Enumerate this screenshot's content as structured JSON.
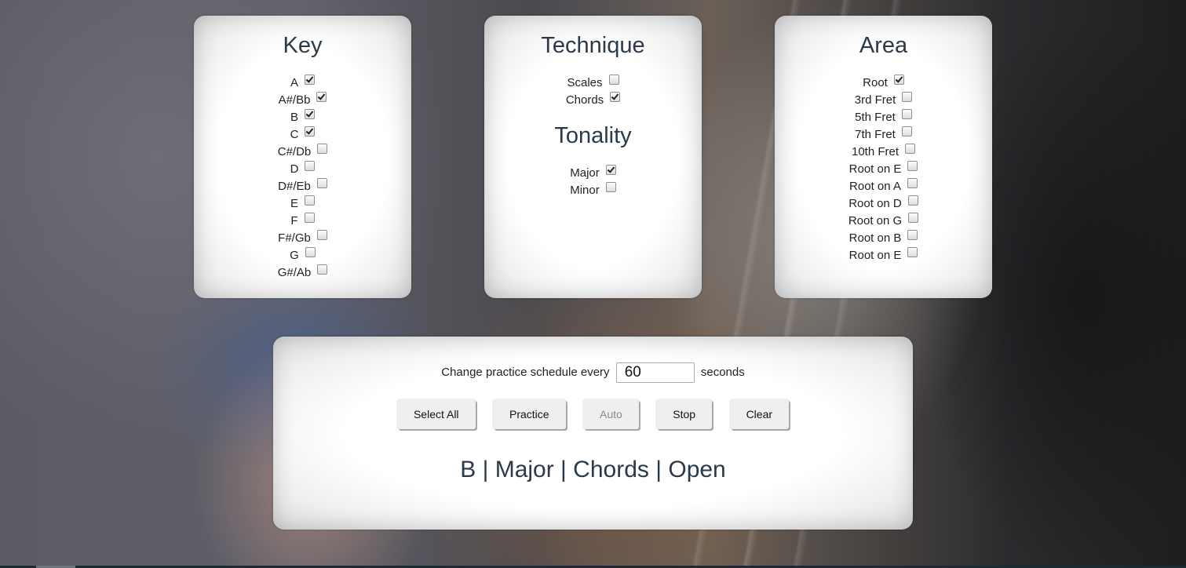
{
  "key": {
    "title": "Key",
    "options": [
      {
        "label": "A",
        "checked": true
      },
      {
        "label": "A#/Bb",
        "checked": true
      },
      {
        "label": "B",
        "checked": true
      },
      {
        "label": "C",
        "checked": true
      },
      {
        "label": "C#/Db",
        "checked": false
      },
      {
        "label": "D",
        "checked": false
      },
      {
        "label": "D#/Eb",
        "checked": false
      },
      {
        "label": "E",
        "checked": false
      },
      {
        "label": "F",
        "checked": false
      },
      {
        "label": "F#/Gb",
        "checked": false
      },
      {
        "label": "G",
        "checked": false
      },
      {
        "label": "G#/Ab",
        "checked": false
      }
    ]
  },
  "technique": {
    "title": "Technique",
    "options": [
      {
        "label": "Scales",
        "checked": false
      },
      {
        "label": "Chords",
        "checked": true
      }
    ]
  },
  "tonality": {
    "title": "Tonality",
    "options": [
      {
        "label": "Major",
        "checked": true
      },
      {
        "label": "Minor",
        "checked": false
      }
    ]
  },
  "area": {
    "title": "Area",
    "options": [
      {
        "label": "Root",
        "checked": true
      },
      {
        "label": "3rd Fret",
        "checked": false
      },
      {
        "label": "5th Fret",
        "checked": false
      },
      {
        "label": "7th Fret",
        "checked": false
      },
      {
        "label": "10th Fret",
        "checked": false
      },
      {
        "label": "Root on E",
        "checked": false
      },
      {
        "label": "Root on A",
        "checked": false
      },
      {
        "label": "Root on D",
        "checked": false
      },
      {
        "label": "Root on G",
        "checked": false
      },
      {
        "label": "Root on B",
        "checked": false
      },
      {
        "label": "Root on E",
        "checked": false
      }
    ]
  },
  "controls": {
    "schedule_prefix": "Change practice schedule every",
    "schedule_value": "60",
    "schedule_suffix": "seconds",
    "buttons": {
      "select_all": "Select All",
      "practice": "Practice",
      "auto": "Auto",
      "stop": "Stop",
      "clear": "Clear"
    },
    "result": "B | Major | Chords | Open"
  }
}
